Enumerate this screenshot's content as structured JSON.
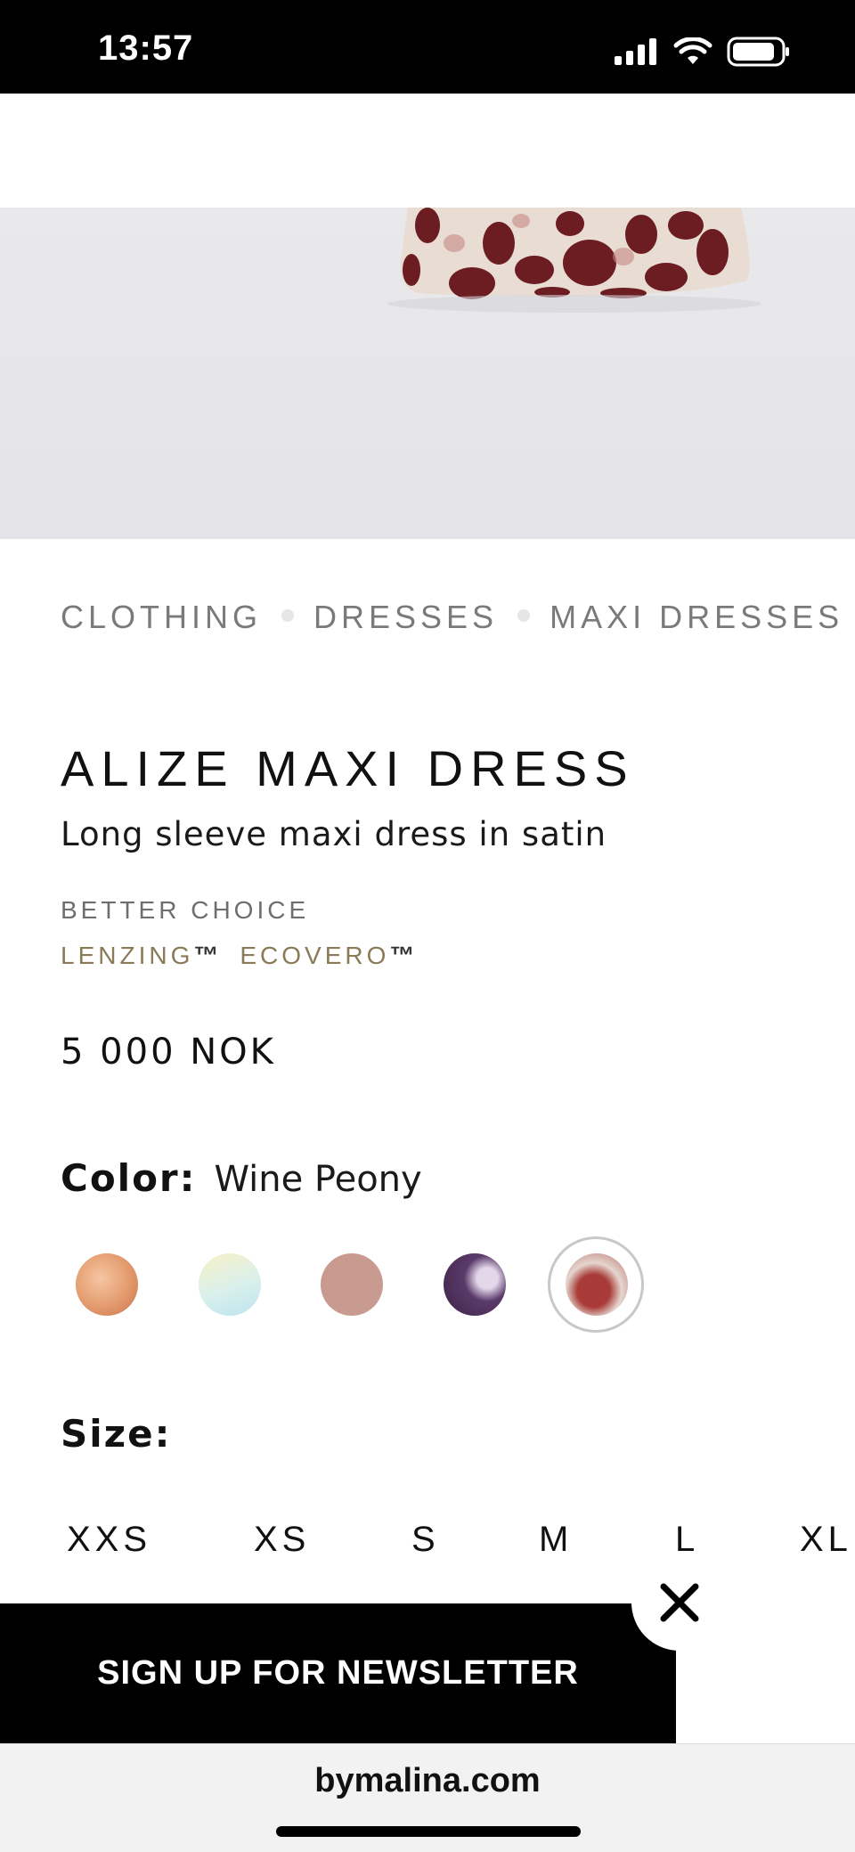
{
  "status_bar": {
    "time": "13:57"
  },
  "breadcrumb": {
    "items": [
      "CLOTHING",
      "DRESSES",
      "MAXI DRESSES"
    ]
  },
  "product": {
    "title": "ALIZE MAXI DRESS",
    "subtitle": "Long sleeve maxi dress in satin",
    "better_choice": "BETTER CHOICE",
    "materials": [
      "LENZING",
      "ECOVERO"
    ],
    "trademark": "™",
    "price": "5 000 NOK"
  },
  "color": {
    "label": "Color:",
    "value": "Wine Peony",
    "swatches": [
      {
        "name": "orange-print",
        "color": "#e3a27a"
      },
      {
        "name": "pastel-ombre",
        "color": "#dfeee6"
      },
      {
        "name": "dusty-rose",
        "color": "#c99b90"
      },
      {
        "name": "purple-print",
        "color": "#5b3a6a"
      },
      {
        "name": "wine-peony",
        "color": "#a34a3c",
        "selected": true
      }
    ]
  },
  "size": {
    "label": "Size:",
    "options": [
      "XXS",
      "XS",
      "S",
      "M",
      "L",
      "XL"
    ]
  },
  "newsletter": {
    "label": "SIGN UP FOR NEWSLETTER"
  },
  "browser": {
    "url": "bymalina.com"
  }
}
